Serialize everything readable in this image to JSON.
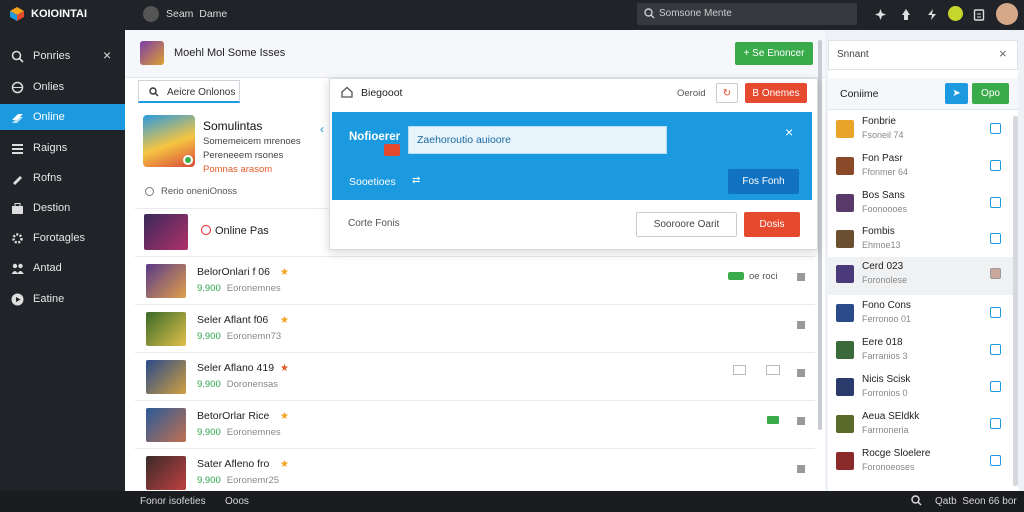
{
  "app": {
    "logo_text": "KOIOINTAI",
    "tab_title": "Seam  Dame"
  },
  "topbar": {
    "search_placeholder": "Somsone Mente"
  },
  "sidebar": {
    "close_label": "×",
    "items": [
      {
        "label": "Ponries",
        "icon": "search-icon"
      },
      {
        "label": "Onlies",
        "icon": "globe-icon"
      },
      {
        "label": "Online",
        "icon": "layers-icon"
      },
      {
        "label": "Raigns",
        "icon": "list-icon"
      },
      {
        "label": "Rofns",
        "icon": "pen-icon"
      },
      {
        "label": "Destion",
        "icon": "briefcase-icon"
      },
      {
        "label": "Forotagles",
        "icon": "gear-icon"
      },
      {
        "label": "Antad",
        "icon": "people-icon"
      },
      {
        "label": "Eatine",
        "icon": "play-icon"
      }
    ]
  },
  "main": {
    "header_title": "Moehl Mol Some Isses",
    "header_button": "+ Se Enoncer",
    "search_tab": "Aeicre Onlonos",
    "profile": {
      "name": "Somulintas",
      "line1": "Somemeicem mrenoes",
      "line2": "Pereneeem rsones",
      "line3": "Pomnas arasom"
    },
    "small_note": "Rerio oneniOnoss",
    "online_label": "Online Pas",
    "rows": [
      {
        "title": "BelorOnlari f 06",
        "price": "9.900",
        "sub": "Eoronemnes"
      },
      {
        "title": "Seler Aflant f06",
        "price": "9.900",
        "sub": "Eoronemn73"
      },
      {
        "title": "Seler Aflano 419",
        "price": "9.900",
        "sub": "Doronensas"
      },
      {
        "title": "BetorOrlar Rice",
        "price": "9.900",
        "sub": "Eoronemnes"
      },
      {
        "title": "Sater Afleno fro",
        "price": "9.900",
        "sub": "Eoronemr25"
      }
    ],
    "row1_badge": "oe roci"
  },
  "dialog": {
    "title": "Biegooot",
    "top_right_label": "Oeroid",
    "danger_button": "B Onemes",
    "banner_label": "Nofioerer",
    "banner_input": "Zaehoroutio auioore",
    "banner_sub": "Sooetioes",
    "banner_button": "Fos Fonh",
    "footer_label": "Corte Fonis",
    "footer_outline_button": "Sooroore Oarit",
    "footer_danger_button": "Dosis"
  },
  "right_panel": {
    "search_value": "Snnant",
    "section_title": "Coniime",
    "green_button": "Opo",
    "items": [
      {
        "a": "Fonbrie",
        "b": "Fsoneil 74",
        "color": "#e8a52a",
        "checked": false
      },
      {
        "a": "Fon Pasr",
        "b": "Ffonmer 64",
        "color": "#8a4a2a",
        "checked": false
      },
      {
        "a": "Bos Sans",
        "b": "Foonoooes",
        "color": "#5a3a6a",
        "checked": false
      },
      {
        "a": "Fombis",
        "b": "Ehmoe13",
        "color": "#6a5030",
        "checked": false
      },
      {
        "a": "Cerd 023",
        "b": "Foronolese",
        "color": "#4a3a7a",
        "checked": true
      },
      {
        "a": "Fono Cons",
        "b": "Ferronoo 01",
        "color": "#2a4a8a",
        "checked": false
      },
      {
        "a": "Eere 018",
        "b": "Farranios 3",
        "color": "#3a6a3a",
        "checked": false
      },
      {
        "a": "Nicis Scisk",
        "b": "Forronios 0",
        "color": "#2a3a6a",
        "checked": false
      },
      {
        "a": "Aeua SEldkk",
        "b": "Farrnoneria",
        "color": "#5a6a2a",
        "checked": false
      },
      {
        "a": "Rocge Sloelere",
        "b": "Foronoeoses",
        "color": "#8a2a2a",
        "checked": false
      }
    ]
  },
  "footer": {
    "left_text": "Fonor isofeties",
    "left_text2": "Ooos",
    "right_text": "Qatb  Seon 66 bor"
  }
}
